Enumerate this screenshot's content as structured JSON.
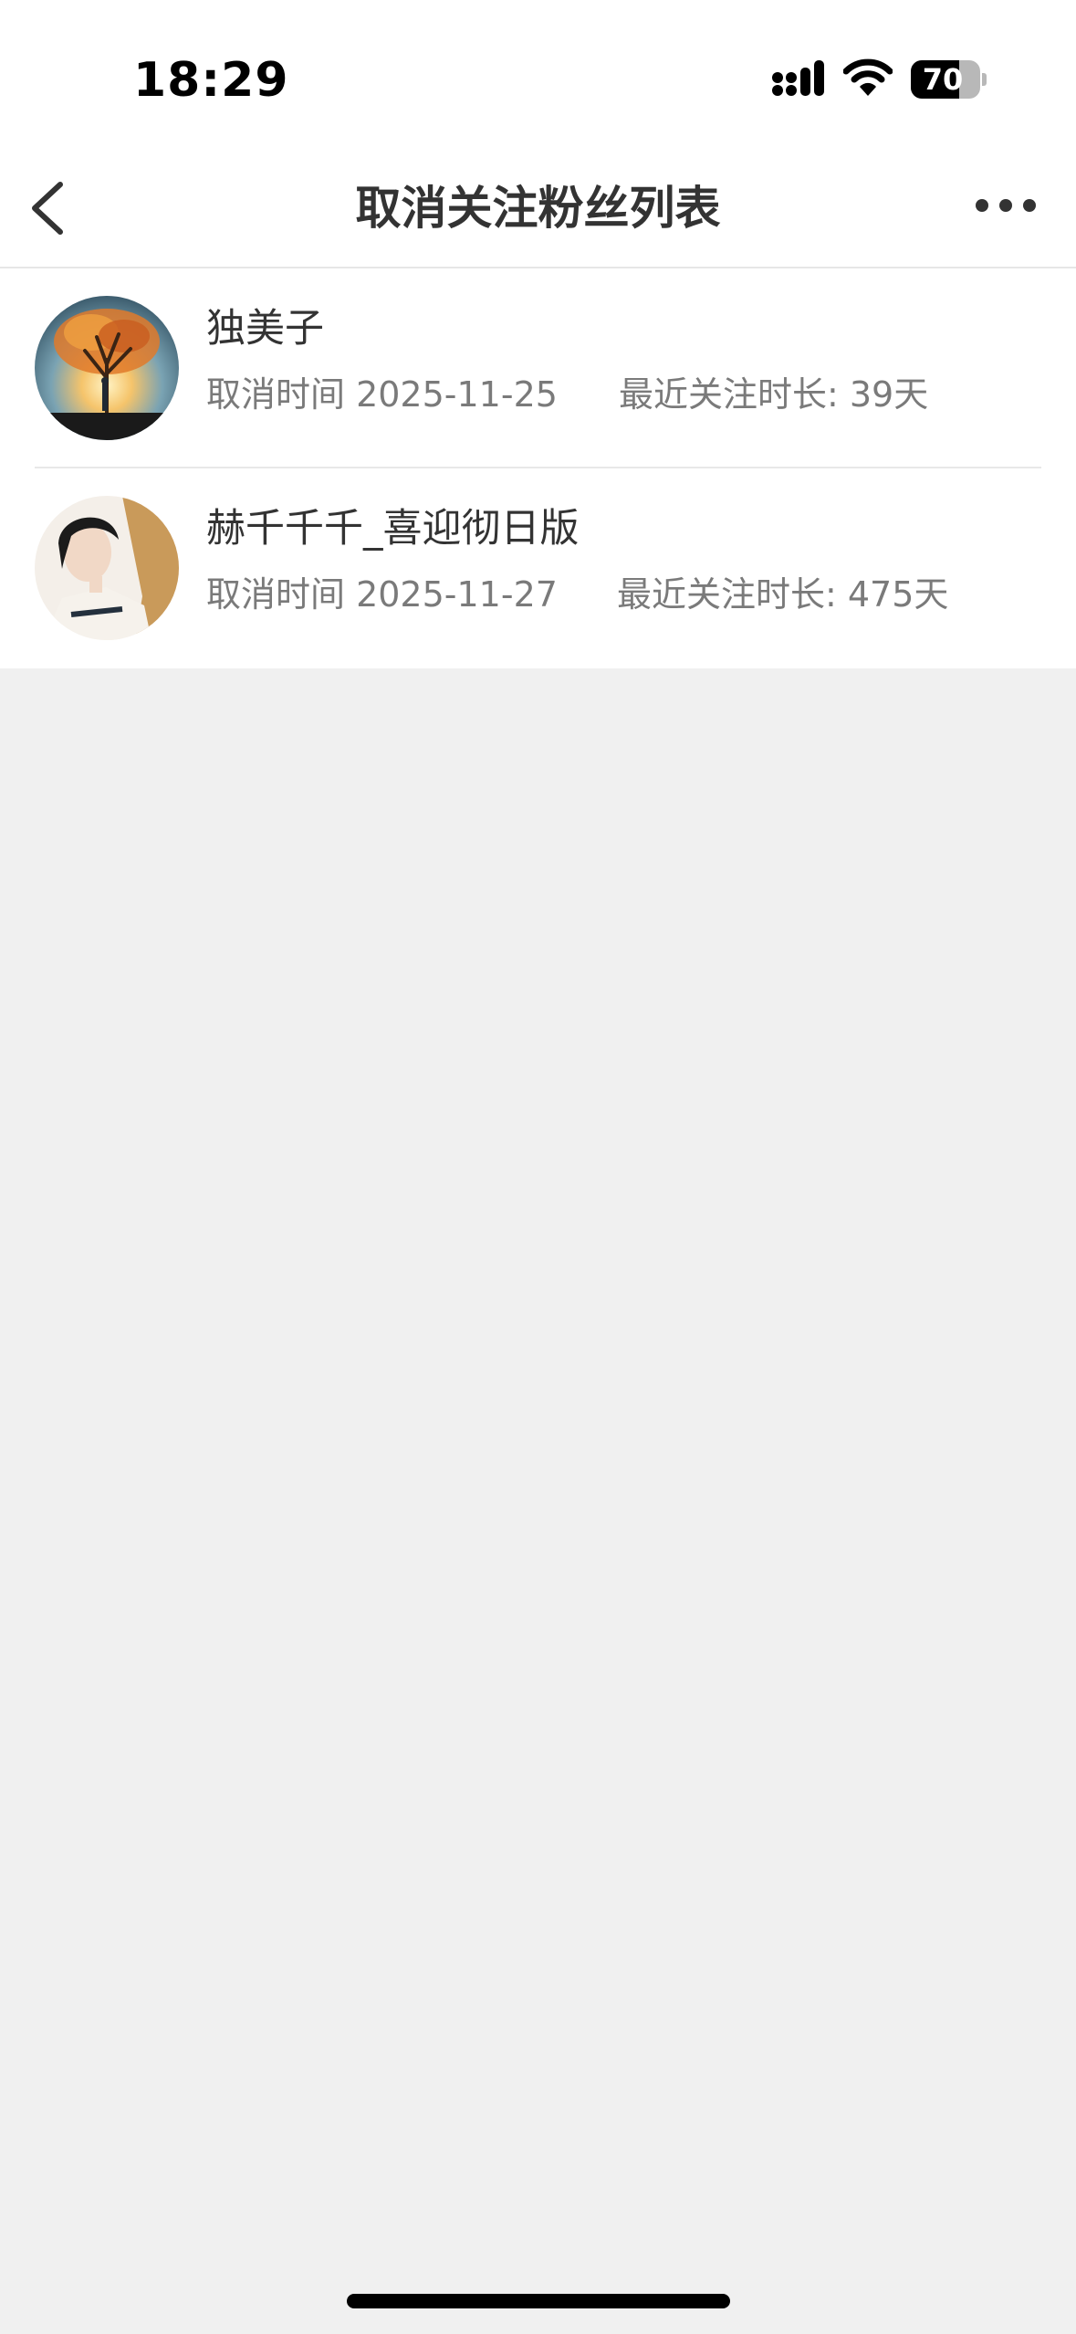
{
  "status_bar": {
    "time": "18:29",
    "battery_level": "70",
    "icons": [
      "signal-icon",
      "wifi-icon",
      "battery-icon"
    ]
  },
  "nav": {
    "title": "取消关注粉丝列表",
    "back_icon": "chevron-left-icon",
    "more_icon": "more-horizontal-icon"
  },
  "list": {
    "items": [
      {
        "name": "独美子",
        "cancel_time": "取消时间 2025-11-25",
        "recent_follow_duration": "最近关注时长: 39天",
        "avatar": "tree-silhouette-avatar"
      },
      {
        "name": "赫千千千_喜迎彻日版",
        "cancel_time": "取消时间 2025-11-27",
        "recent_follow_duration": "最近关注时长: 475天",
        "avatar": "person-photo-avatar"
      }
    ]
  },
  "colors": {
    "background": "#f0f0f0",
    "surface": "#ffffff",
    "text_primary": "#333333",
    "text_secondary": "#7a7a7a",
    "divider": "#e8e8e8"
  }
}
